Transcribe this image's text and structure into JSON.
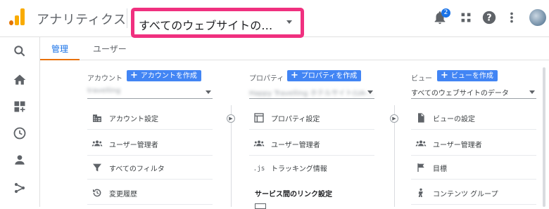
{
  "header": {
    "app_title": "アナリティクス",
    "account_selector": "すべてのウェブサイトの…",
    "notification_count": "2",
    "brand_color": "#f9ab00",
    "highlight_color": "#f0307f"
  },
  "tabs": [
    {
      "label": "管理",
      "active": true
    },
    {
      "label": "ユーザー",
      "active": false
    }
  ],
  "nav_icons": [
    "search-icon",
    "home-icon",
    "dashboard-icon",
    "clock-icon",
    "person-icon",
    "share-icon"
  ],
  "columns": {
    "account": {
      "title": "アカウント",
      "create_label": "アカウントを作成",
      "selected": "travelling",
      "items": [
        {
          "label": "アカウント設定",
          "icon": "building-icon"
        },
        {
          "label": "ユーザー管理者",
          "icon": "people-icon"
        },
        {
          "label": "すべてのフィルタ",
          "icon": "filter-icon"
        },
        {
          "label": "変更履歴",
          "icon": "history-icon"
        }
      ]
    },
    "property": {
      "title": "プロパティ",
      "create_label": "プロパティを作成",
      "selected": "Happy Travelling ホテルサイト(UA-...",
      "items": [
        {
          "label": "プロパティ設定",
          "icon": "window-icon"
        },
        {
          "label": "ユーザー管理者",
          "icon": "people-icon"
        },
        {
          "label": "トラッキング情報",
          "icon": "js-icon"
        }
      ],
      "section": "サービス間のリンク設定"
    },
    "view": {
      "title": "ビュー",
      "create_label": "ビューを作成",
      "selected": "すべてのウェブサイトのデータ",
      "items": [
        {
          "label": "ビューの設定",
          "icon": "document-icon"
        },
        {
          "label": "ユーザー管理者",
          "icon": "people-icon"
        },
        {
          "label": "目標",
          "icon": "flag-icon"
        },
        {
          "label": "コンテンツ グループ",
          "icon": "person-group-icon"
        }
      ]
    }
  }
}
